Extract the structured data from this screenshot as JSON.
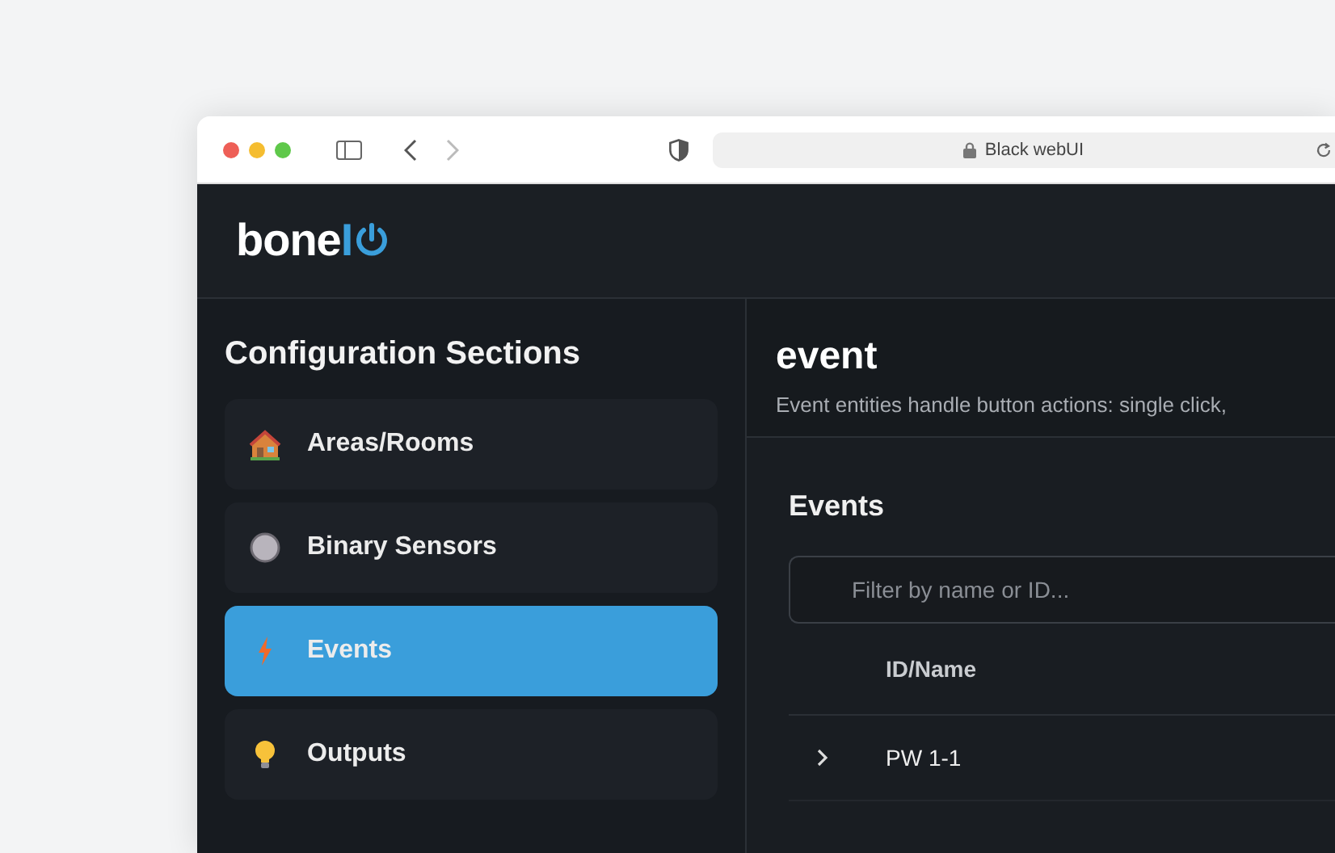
{
  "browser": {
    "address": "Black webUI",
    "forward_disabled": true
  },
  "logo": {
    "text": "bone",
    "accent": "I"
  },
  "sidebar": {
    "title": "Configuration Sections",
    "items": [
      {
        "label": "Areas/Rooms",
        "kind": "house",
        "selected": false
      },
      {
        "label": "Binary Sensors",
        "kind": "circle",
        "selected": false
      },
      {
        "label": "Events",
        "kind": "bolt",
        "selected": true
      },
      {
        "label": "Outputs",
        "kind": "bulb",
        "selected": false
      }
    ]
  },
  "main": {
    "title": "event",
    "description": "Event entities handle button actions: single click,",
    "section_title": "Events",
    "filter": {
      "placeholder": "Filter by name or ID..."
    },
    "table": {
      "columns": [
        "ID/Name"
      ],
      "rows": [
        {
          "name": "PW 1-1",
          "expanded": false
        }
      ]
    }
  }
}
